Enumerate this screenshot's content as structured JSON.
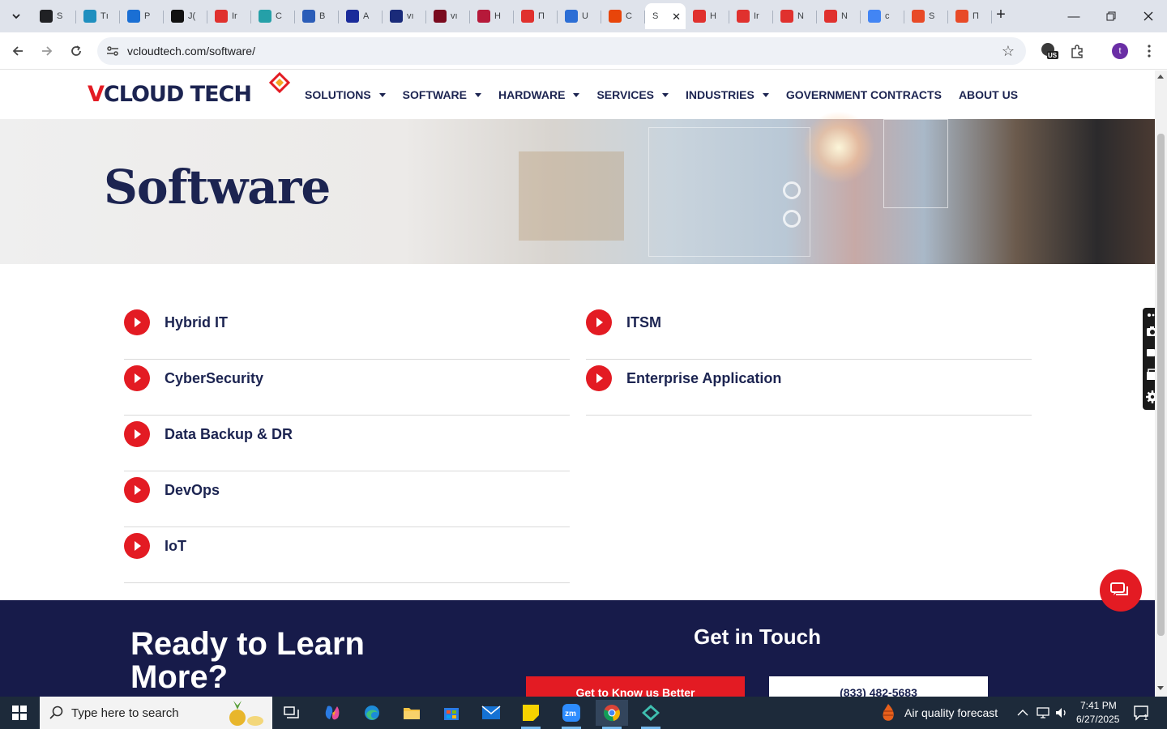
{
  "browser": {
    "tabs": [
      {
        "text": "S",
        "color": "#202124"
      },
      {
        "text": "Tı",
        "color": "#1f8fbf"
      },
      {
        "text": "P",
        "color": "#1a6fd4"
      },
      {
        "text": "J(",
        "color": "#111111"
      },
      {
        "text": "Ir",
        "color": "#e0312e"
      },
      {
        "text": "C",
        "color": "#25a0a8"
      },
      {
        "text": "B",
        "color": "#2b5db8"
      },
      {
        "text": "A",
        "color": "#1a2b9a"
      },
      {
        "text": "vı",
        "color": "#1a2b7a"
      },
      {
        "text": "vı",
        "color": "#7a0a1e"
      },
      {
        "text": "H",
        "color": "#b6193a"
      },
      {
        "text": "П",
        "color": "#e0312e"
      },
      {
        "text": "U",
        "color": "#2c6ed5"
      },
      {
        "text": "C",
        "color": "#e8450a"
      },
      {
        "text": "S",
        "color": "#ffffff",
        "active": true
      },
      {
        "text": "H",
        "color": "#e0312e"
      },
      {
        "text": "Ir",
        "color": "#e0312e"
      },
      {
        "text": "N",
        "color": "#e0312e"
      },
      {
        "text": "N",
        "color": "#e0312e"
      },
      {
        "text": "c",
        "color": "#4285f4"
      },
      {
        "text": "S",
        "color": "#e84a27"
      },
      {
        "text": "П",
        "color": "#e84a27"
      }
    ],
    "url": "vcloudtech.com/software/",
    "profile_initial": "t",
    "ext_badge": "US"
  },
  "site": {
    "logo_parts": [
      "V",
      "CLOUD",
      " TECH"
    ],
    "nav": [
      {
        "label": "SOLUTIONS",
        "dropdown": true
      },
      {
        "label": "SOFTWARE",
        "dropdown": true
      },
      {
        "label": "HARDWARE",
        "dropdown": true
      },
      {
        "label": "SERVICES",
        "dropdown": true
      },
      {
        "label": "INDUSTRIES",
        "dropdown": true
      },
      {
        "label": "GOVERNMENT CONTRACTS",
        "dropdown": false
      },
      {
        "label": "ABOUT US",
        "dropdown": false
      }
    ],
    "hero_title": "Software",
    "categories_left": [
      "Hybrid IT",
      "CyberSecurity",
      "Data Backup & DR",
      "DevOps",
      "IoT"
    ],
    "categories_right": [
      "ITSM",
      "Enterprise Application"
    ],
    "footer": {
      "title": "Ready to Learn More?",
      "touch": "Get in Touch",
      "btn_red": "Get to Know us Better",
      "btn_white": "(833) 482-5683"
    },
    "colors": {
      "brand_navy": "#1c2451",
      "brand_red": "#e31b23",
      "footer_bg": "#171b4a"
    }
  },
  "taskbar": {
    "search_placeholder": "Type here to search",
    "weather": "Air quality forecast",
    "time": "7:41 PM",
    "date": "6/27/2025",
    "notification_count": "1",
    "apps": [
      "task-view-icon",
      "copilot-icon",
      "edge-icon",
      "file-explorer-icon",
      "store-icon",
      "mail-icon",
      "sticky-notes-icon",
      "zoom-icon",
      "chrome-icon",
      "app-icon"
    ]
  }
}
